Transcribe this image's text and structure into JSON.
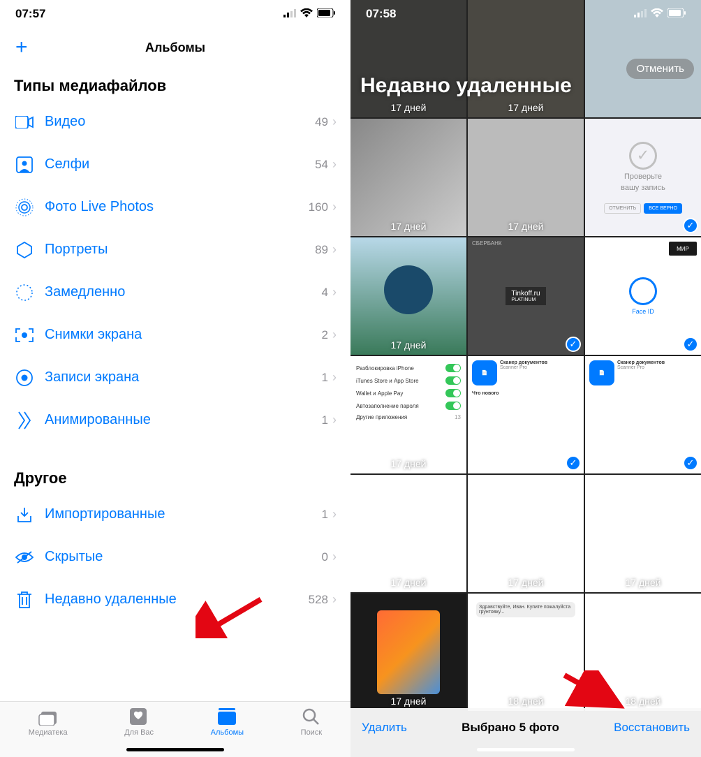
{
  "p1": {
    "time": "07:57",
    "header_title": "Альбомы",
    "section1_title": "Типы медиафайлов",
    "section2_title": "Другое",
    "media_types": [
      {
        "icon": "video",
        "label": "Видео",
        "count": "49"
      },
      {
        "icon": "selfie",
        "label": "Селфи",
        "count": "54"
      },
      {
        "icon": "live",
        "label": "Фото Live Photos",
        "count": "160"
      },
      {
        "icon": "portrait",
        "label": "Портреты",
        "count": "89"
      },
      {
        "icon": "slomo",
        "label": "Замедленно",
        "count": "4"
      },
      {
        "icon": "screenshot",
        "label": "Снимки экрана",
        "count": "2"
      },
      {
        "icon": "record",
        "label": "Записи экрана",
        "count": "1"
      },
      {
        "icon": "animated",
        "label": "Анимированные",
        "count": "1"
      }
    ],
    "other": [
      {
        "icon": "import",
        "label": "Импортированные",
        "count": "1"
      },
      {
        "icon": "hidden",
        "label": "Скрытые",
        "count": "0"
      },
      {
        "icon": "trash",
        "label": "Недавно удаленные",
        "count": "528"
      }
    ],
    "tabs": [
      {
        "label": "Медиатека"
      },
      {
        "label": "Для Вас"
      },
      {
        "label": "Альбомы"
      },
      {
        "label": "Поиск"
      }
    ]
  },
  "p2": {
    "time": "07:58",
    "title": "Недавно удаленные",
    "cancel": "Отменить",
    "days_label": "17 дней",
    "days_label_18": "18 дней",
    "verify_line1": "Проверьте",
    "verify_line2": "вашу запись",
    "verify_btn1": "ОТМЕНИТЬ",
    "verify_btn2": "ВСЕ ВЕРНО",
    "tinkoff": "Tinkoff.ru",
    "tinkoff_sub": "PLATINUM",
    "sber": "СБЕРБАНК",
    "faceid": "Face ID",
    "mir": "МИР",
    "scanner": "Сканер документов",
    "scanner_sub": "Scanner Pro",
    "toolbar_delete": "Удалить",
    "toolbar_mid": "Выбрано 5 фото",
    "toolbar_restore": "Восстановить"
  }
}
